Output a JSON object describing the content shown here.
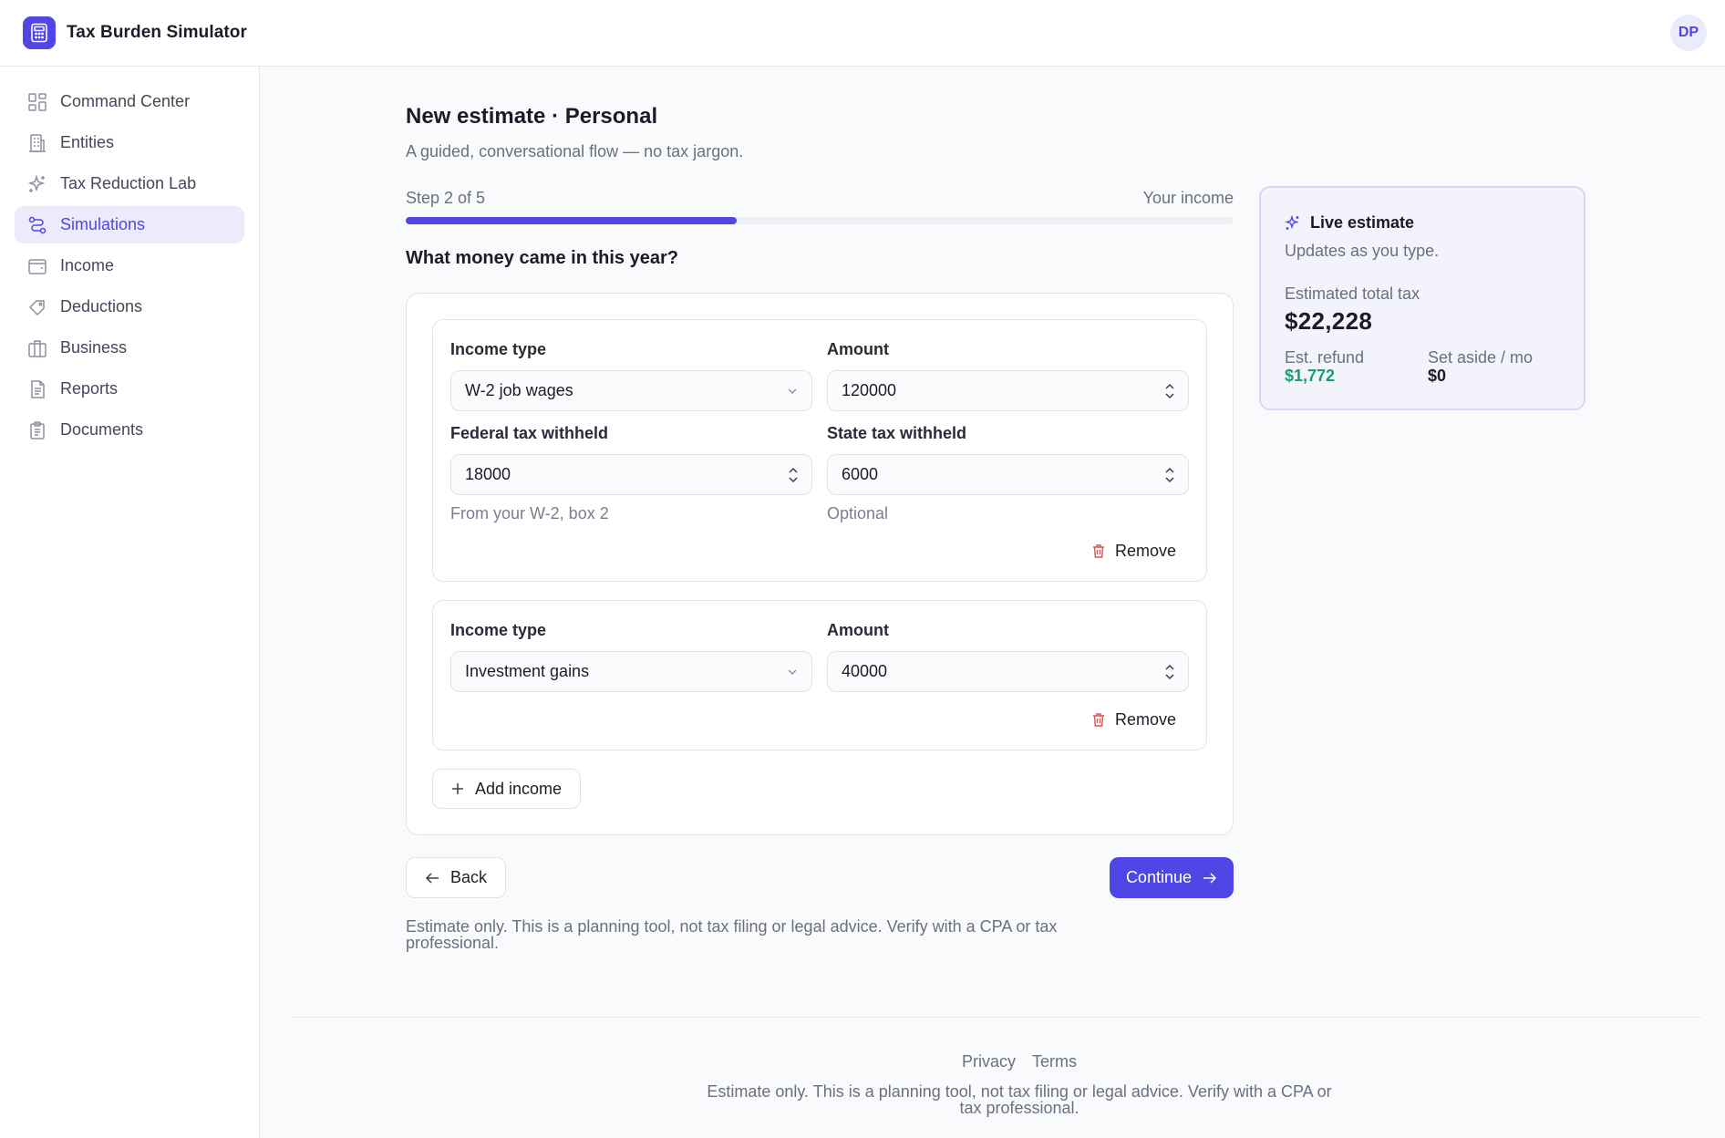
{
  "app": {
    "title": "Tax Burden Simulator",
    "avatar_initials": "DP",
    "accent_color": "#4f46e5"
  },
  "sidebar": {
    "items": [
      {
        "label": "Command Center",
        "icon": "grid-icon"
      },
      {
        "label": "Entities",
        "icon": "building-icon"
      },
      {
        "label": "Tax Reduction Lab",
        "icon": "sparkle-icon"
      },
      {
        "label": "Simulations",
        "icon": "route-icon",
        "active": true
      },
      {
        "label": "Income",
        "icon": "wallet-icon"
      },
      {
        "label": "Deductions",
        "icon": "tag-icon"
      },
      {
        "label": "Business",
        "icon": "briefcase-icon"
      },
      {
        "label": "Reports",
        "icon": "report-icon"
      },
      {
        "label": "Documents",
        "icon": "clipboard-icon"
      }
    ]
  },
  "page": {
    "title": "New estimate · Personal",
    "subtitle": "A guided, conversational flow — no tax jargon.",
    "step_label": "Step 2 of 5",
    "step_name": "Your income",
    "progress_fraction": 0.4,
    "question": "What money came in this year?"
  },
  "incomes": [
    {
      "type_label": "Income type",
      "type_value": "W-2 job wages",
      "amount_label": "Amount",
      "amount_value": "120000",
      "federal_label": "Federal tax withheld",
      "federal_value": "18000",
      "federal_hint": "From your W-2, box 2",
      "state_label": "State tax withheld",
      "state_value": "6000",
      "state_hint": "Optional",
      "remove_label": "Remove"
    },
    {
      "type_label": "Income type",
      "type_value": "Investment gains",
      "amount_label": "Amount",
      "amount_value": "40000",
      "remove_label": "Remove"
    }
  ],
  "actions": {
    "add_income": "Add income",
    "back": "Back",
    "continue": "Continue"
  },
  "disclaimer": "Estimate only. This is a planning tool, not tax filing or legal advice. Verify with a CPA or tax professional.",
  "estimate": {
    "title": "Live estimate",
    "subtitle": "Updates as you type.",
    "total_label": "Estimated total tax",
    "total_value": "$22,228",
    "refund_label": "Est. refund",
    "refund_value": "$1,772",
    "refund_color": "#15a06a",
    "aside_label": "Set aside / mo",
    "aside_value": "$0"
  },
  "footer": {
    "privacy": "Privacy",
    "terms": "Terms",
    "note": "Estimate only. This is a planning tool, not tax filing or legal advice. Verify with a CPA or tax professional."
  }
}
